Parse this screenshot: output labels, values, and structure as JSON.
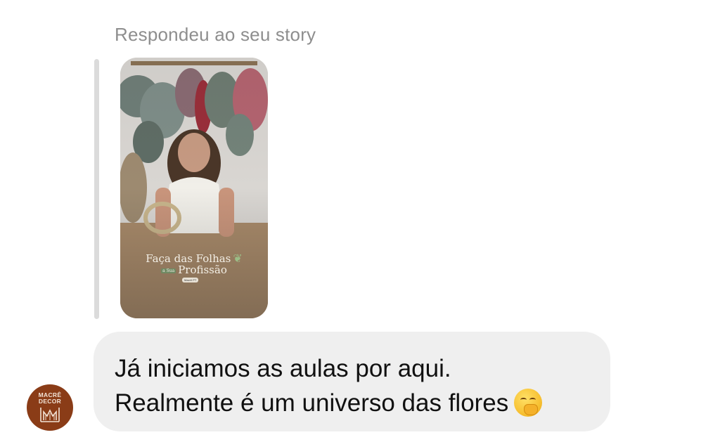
{
  "reply": {
    "label": "Respondeu ao seu story"
  },
  "story": {
    "title_line1": "Faça das Folhas",
    "title_small": "a Sua",
    "title_line2": "Profissão",
    "tag": "Macrê PT",
    "leaf_icon": "leaf-icon"
  },
  "message": {
    "line1": "Já iniciamos as aulas por aqui.",
    "line2": "Realmente é um universo das flores",
    "emoji": "face-with-hand-over-mouth-emoji"
  },
  "sender": {
    "avatar_brand_line1": "MACRÊ",
    "avatar_brand_line2": "DECOR",
    "avatar_icon": "macre-decor-logo-icon",
    "colors": {
      "avatar_bg": "#8a3c17"
    }
  },
  "colors": {
    "bubble_bg": "#efefef",
    "reply_label": "#8e8e8e",
    "reply_bar": "#dbdbdb"
  }
}
